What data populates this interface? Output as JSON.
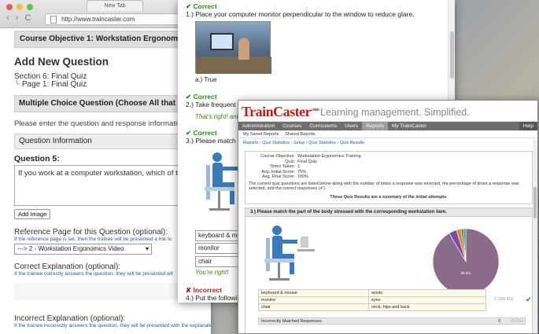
{
  "browser": {
    "tab_title": "New Tab",
    "url": "http://www.traincaster.com",
    "back_glyph": "‹",
    "forward_glyph": "›",
    "reload_glyph": "C",
    "traffic_lights": {
      "close": "#ee5c54",
      "minimize": "#f9bd3a",
      "maximize": "#5ec643"
    }
  },
  "editor": {
    "course_objective": "Course Objective 1: Workstation Ergonomics Traini",
    "page_heading": "Add New Question",
    "section_label": "Section 6:",
    "section_value": "Final Quiz",
    "page_label": "Page 1:",
    "page_value": "Final Quiz",
    "question_type": "Multiple Choice Question (Choose All that Appl",
    "instructions": "Please enter the question and response information",
    "question_info_header": "Question Information",
    "question_label": "Question 5:",
    "question_text": "If you work at a computer workstation, which of the",
    "add_image_label": "Add Image",
    "reference_label": "Reference Page for this Question (optional):",
    "reference_hint": "If the reference page is set, then the trainee will be presented a link to",
    "reference_selected": "---> 2 - Workstation Ergonomics Video",
    "correct_expl_label": "Correct Explanation (optional):",
    "correct_expl_hint": "If the trainee correctly answers the question, they will be presented wit",
    "incorrect_expl_label": "Incorrect Explanation (optional):",
    "incorrect_expl_hint": "If the trainee incorrectly answers the question, they will be presented with the explanation"
  },
  "quiz": {
    "q1_status": "✔ Correct",
    "q1_text": "1.)  Place your computer monitor perpendicular to the window to reduce glare.",
    "q1_answer": "a.)  True",
    "q2_status": "✔ Correct",
    "q2_text": "2.)  Take frequent",
    "q2_feedback": "That's right! and",
    "q3_status": "✔ Correct",
    "q3_text": "3.)  Please match the",
    "match_items": [
      "keyboard & mou",
      "monitor",
      "chair"
    ],
    "q3_feedback": "You're right!",
    "q4_status": "✘ Incorrect",
    "q4_text": "4.)  Put the following"
  },
  "traincaster": {
    "logo_text": "TrainCaster",
    "logo_suffix": ".com",
    "tagline": "Learning management. Simplified.",
    "nav": [
      "Administration",
      "Courses",
      "Curriculums",
      "Users",
      "Reports",
      "My TrainCaster"
    ],
    "nav_active": "Reports",
    "nav_help": "Help",
    "subnav": [
      "My Saved Reports",
      "Shared Reports"
    ],
    "breadcrumb": "Reports  ›  Quiz Statistics - Setup  ›  Quiz Statistics  ›  Quiz Results",
    "summary": {
      "course_objective_label": "Course Objective:",
      "course_objective": "Workstation Ergonomics Training",
      "quiz_label": "Quiz:",
      "quiz": "Final Quiz",
      "times_taken_label": "Times Taken:",
      "times_taken": "1",
      "avg_initial_label": "Avg. Initial Score:",
      "avg_initial": "75%",
      "avg_final_label": "Avg. Final Score:",
      "avg_final": "100%",
      "note": "The current quiz questions are listed below along with the number of times a response was selected, the percentage of times a response was selected, and the correct responses (✔).",
      "results_note": "These Quiz Results are a summary of the initial attempts."
    },
    "question_header": "3.)  Please match the part of the body stressed with the corresponding workstation item.",
    "responses": [
      {
        "item": "keyboard & mouse",
        "match": "wrists"
      },
      {
        "item": "monitor",
        "match": "eyes"
      },
      {
        "item": "chair",
        "match": "neck, hips and back"
      }
    ],
    "response_pct": "1  (100.0%)",
    "pie_label": "85.0%",
    "incorrect_label": "Incorrectly Matched Responses",
    "incorrect_count": "0",
    "incorrect_pct": "(0.0%)",
    "colors": {
      "brand_red": "#b81e1e",
      "nav_gray": "#6e6e6e",
      "pie_main": "#8a6b8a",
      "pie_green": "#4a9a3a",
      "pie_blue": "#3a7ab8",
      "pie_orange": "#e08a2a",
      "pie_purple": "#7a4aa8"
    }
  }
}
